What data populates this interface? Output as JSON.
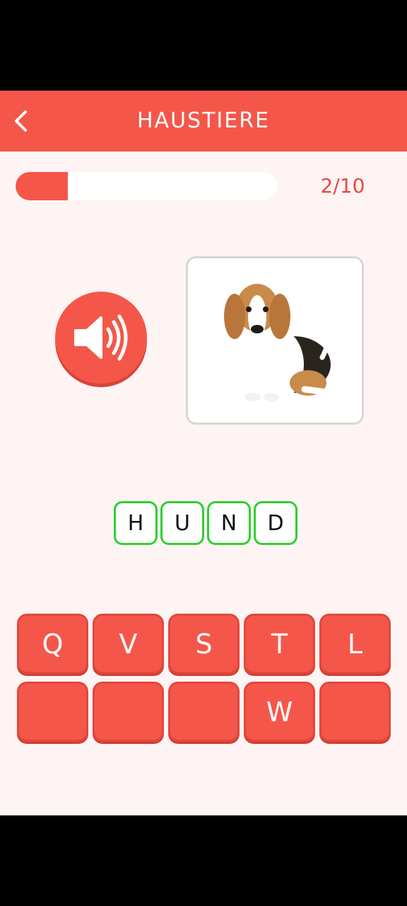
{
  "header": {
    "title": "HAUSTIERE",
    "back_icon": "chevron-left-icon"
  },
  "progress": {
    "current": 2,
    "total": 10,
    "label": "2/10",
    "fill_fraction": 0.2
  },
  "speaker": {
    "icon": "speaker-icon"
  },
  "picture": {
    "subject": "dog-illustration"
  },
  "answer": {
    "letters": [
      "H",
      "U",
      "N",
      "D"
    ]
  },
  "keyboard": {
    "keys": [
      "Q",
      "V",
      "S",
      "T",
      "L",
      "",
      "",
      "",
      "W",
      ""
    ]
  },
  "colors": {
    "primary": "#f4574a",
    "background": "#fff4f4",
    "correct_border": "#2fd02f",
    "progress_text": "#e8473d"
  }
}
